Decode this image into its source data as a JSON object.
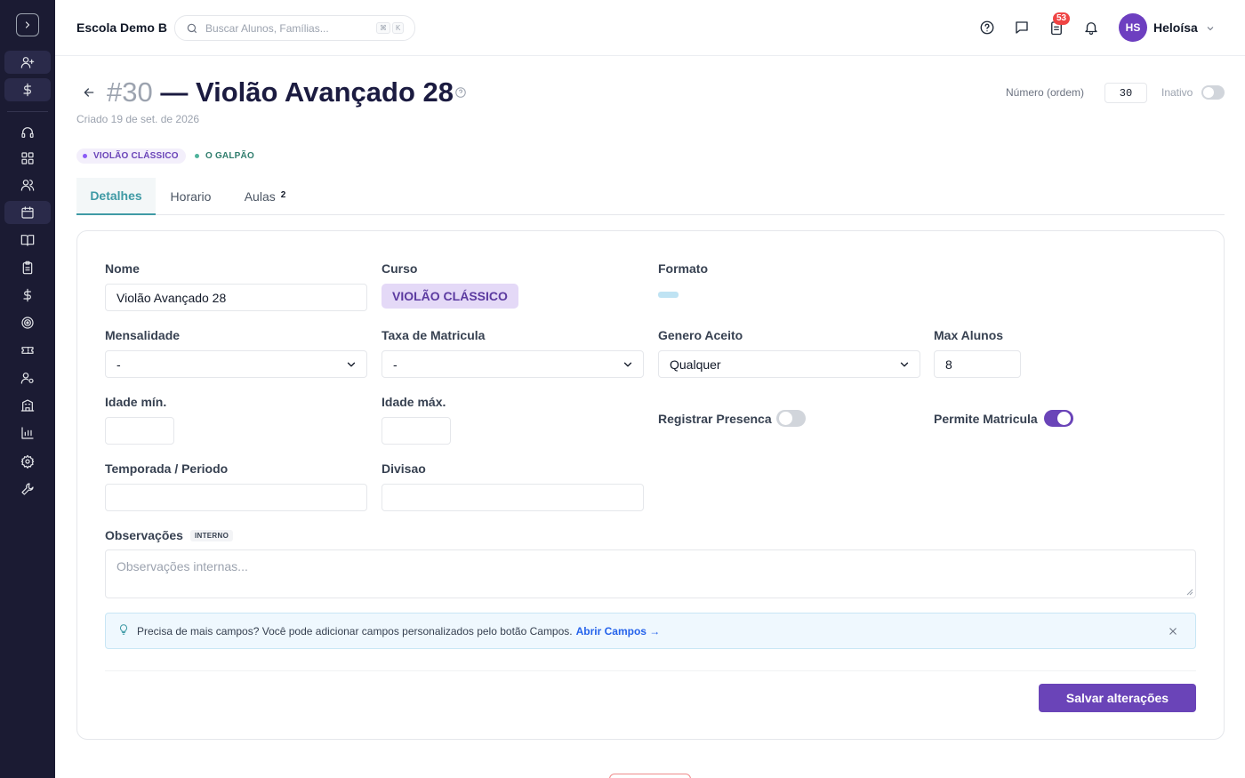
{
  "colors": {
    "sidebar_bg": "#1b1b33",
    "accent_teal": "#3f9aa5",
    "brand_purple": "#6a44b8",
    "toggle_on": "#6a44b8",
    "toggle_off": "#d1d5db",
    "notification_badge": "#ef4444"
  },
  "sidebar": {
    "toggle_icon": "chevron-right-icon",
    "items": [
      {
        "icon": "user-plus-icon"
      },
      {
        "icon": "dollar-icon"
      },
      {
        "icon": "headset-icon"
      },
      {
        "icon": "grid-icon"
      },
      {
        "icon": "users-icon"
      },
      {
        "icon": "calendar-icon"
      },
      {
        "icon": "book-icon"
      },
      {
        "icon": "clipboard-icon"
      },
      {
        "icon": "dollar-icon"
      },
      {
        "icon": "target-icon"
      },
      {
        "icon": "ticket-icon"
      },
      {
        "icon": "user-gear-icon"
      },
      {
        "icon": "building-icon"
      },
      {
        "icon": "bar-chart-icon"
      },
      {
        "icon": "gear-icon"
      },
      {
        "icon": "wrench-icon"
      }
    ]
  },
  "header": {
    "school_name": "Escola Demo B",
    "search_placeholder": "Buscar Alunos, Famílias...",
    "kbd_1": "⌘",
    "kbd_2": "K",
    "notification_count": "53",
    "avatar_initials": "HS",
    "user_name": "Heloísa"
  },
  "page": {
    "number": "#30",
    "title": "— Violão Avançado 28",
    "created": "Criado 19 de set. de 2026",
    "order_label": "Número (ordem)",
    "order_value": "30",
    "inactive_label": "Inativo",
    "inactive_on": false,
    "tags": [
      "VIOLÃO CLÁSSICO",
      "O GALPÃO"
    ]
  },
  "tabs": [
    {
      "label": "Detalhes",
      "active": true
    },
    {
      "label": "Horario"
    },
    {
      "label": "Aulas",
      "count": "2"
    }
  ],
  "form": {
    "nome_label": "Nome",
    "nome_value": "Violão Avançado 28",
    "curso_label": "Curso",
    "curso_value": "VIOLÃO CLÁSSICO",
    "formato_label": "Formato",
    "mensalidade_label": "Mensalidade",
    "mensalidade_value": "-",
    "taxa_label": "Taxa de Matricula",
    "taxa_value": "-",
    "genero_label": "Genero Aceito",
    "genero_value": "Qualquer",
    "max_label": "Max Alunos",
    "max_value": "8",
    "idade_min_label": "Idade mín.",
    "idade_min_value": "",
    "idade_max_label": "Idade máx.",
    "idade_max_value": "",
    "presenca_label": "Registrar Presenca",
    "presenca_on": false,
    "permite_label": "Permite Matricula",
    "permite_on": true,
    "temporada_label": "Temporada / Periodo",
    "temporada_value": "",
    "divisao_label": "Divisao",
    "divisao_value": "",
    "obs_label": "Observações",
    "obs_tag": "INTERNO",
    "obs_placeholder": "Observações internas..."
  },
  "info": {
    "text": "Precisa de mais campos? Você pode adicionar campos personalizados pelo botão Campos.",
    "link": "Abrir Campos →"
  },
  "save_label": "Salvar alterações"
}
